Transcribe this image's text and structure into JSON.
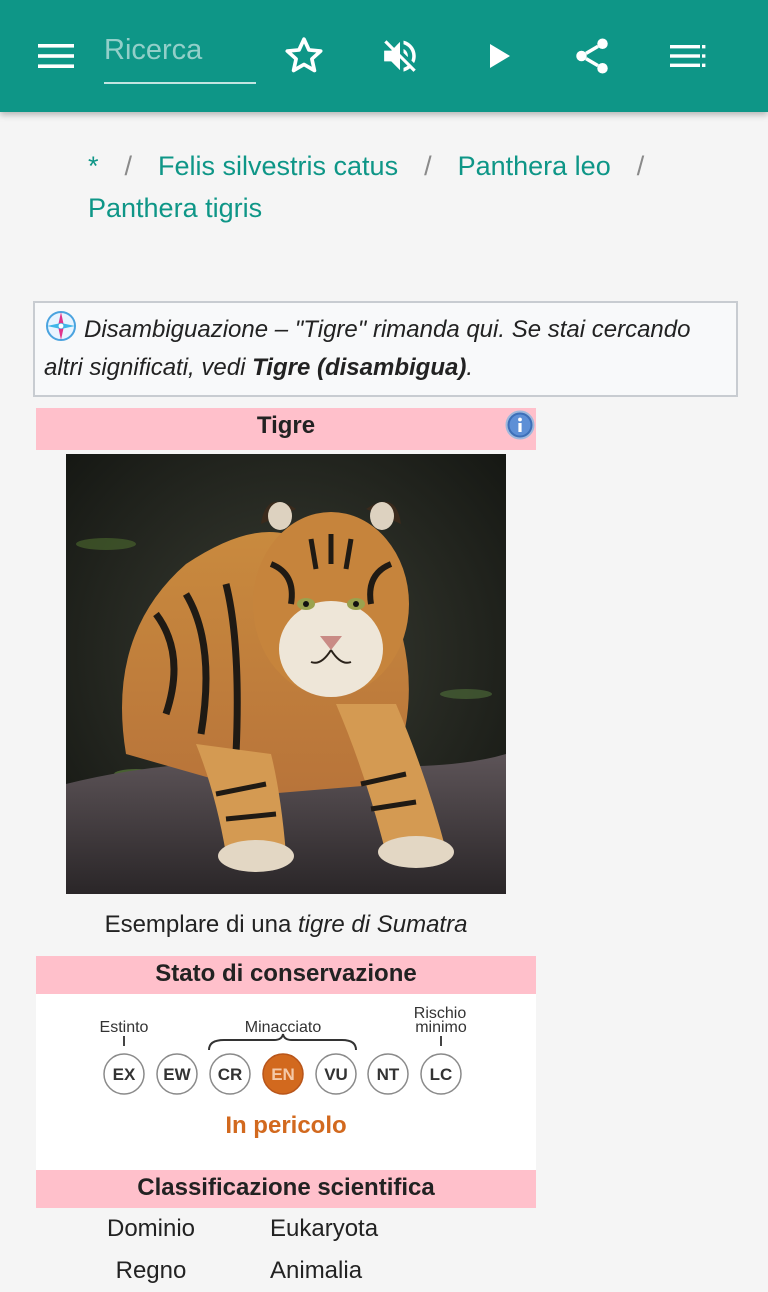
{
  "appbar": {
    "background": "#0e9687",
    "search_placeholder": "Ricerca",
    "icons": [
      "menu-icon",
      "star-icon",
      "volume-off-icon",
      "play-icon",
      "share-icon",
      "list-more-icon"
    ]
  },
  "breadcrumb": {
    "items": [
      "*",
      "Felis silvestris catus",
      "Panthera leo",
      "Panthera tigris"
    ],
    "separator": "/"
  },
  "hatnote": {
    "text": "Disambiguazione – \"Tigre\" rimanda qui. Se stai cercando altri significati, vedi ",
    "link": "Tigre (disambigua)",
    "end": "."
  },
  "infobox": {
    "title": "Tigre",
    "caption_pre": "Esemplare di una ",
    "caption_italic": "tigre di Sumatra",
    "conservation": {
      "header": "Stato di conservazione",
      "labels": {
        "extinct": "Estinto",
        "threatened": "Minacciato",
        "least_concern": "Rischio minimo"
      },
      "codes": [
        "EX",
        "EW",
        "CR",
        "EN",
        "VU",
        "NT",
        "LC"
      ],
      "selected": "EN",
      "status": "In pericolo",
      "accent": "#d2691e"
    },
    "classification": {
      "header": "Classificazione scientifica",
      "rows": [
        {
          "rank": "Dominio",
          "value": "Eukaryota"
        },
        {
          "rank": "Regno",
          "value": "Animalia"
        }
      ]
    },
    "header_color": "#ffc0cb"
  }
}
